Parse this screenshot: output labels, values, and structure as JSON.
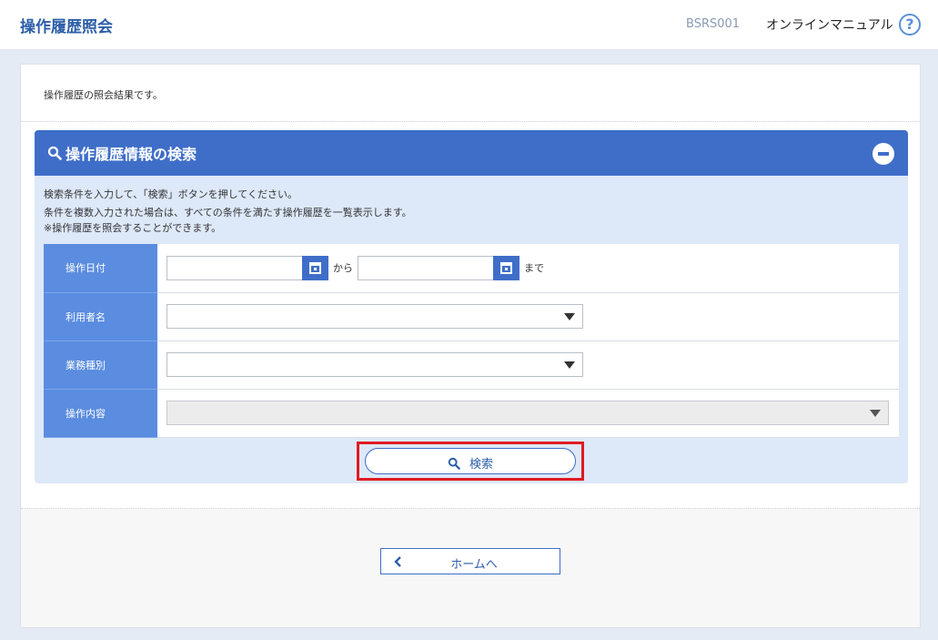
{
  "header": {
    "title": "操作履歴照会",
    "screen_id": "BSRS001",
    "manual_label": "オンラインマニュアル",
    "help_glyph": "?"
  },
  "intro_text": "操作履歴の照会結果です。",
  "search_panel": {
    "title": "操作履歴情報の検索",
    "descriptions": [
      "検索条件を入力して、「検索」ボタンを押してください。",
      "条件を複数入力された場合は、すべての条件を満たす操作履歴を一覧表示します。",
      "※操作履歴を照会することができます。"
    ],
    "fields": {
      "date": {
        "label": "操作日付",
        "from_value": "",
        "to_value": "",
        "from_text": "から",
        "to_text": "まで"
      },
      "user": {
        "label": "利用者名",
        "value": ""
      },
      "business": {
        "label": "業務種別",
        "value": ""
      },
      "operation": {
        "label": "操作内容",
        "value": ""
      }
    },
    "search_button_label": "検索"
  },
  "home_button_label": "ホームへ",
  "colors": {
    "accent": "#3f6ec9",
    "label_bg": "#5a8ce0",
    "highlight": "#e01a22"
  },
  "icons": {
    "search": "search-icon",
    "calendar": "calendar-icon",
    "collapse": "minus-circle-icon",
    "help": "help-icon",
    "back": "chevron-left-icon"
  }
}
